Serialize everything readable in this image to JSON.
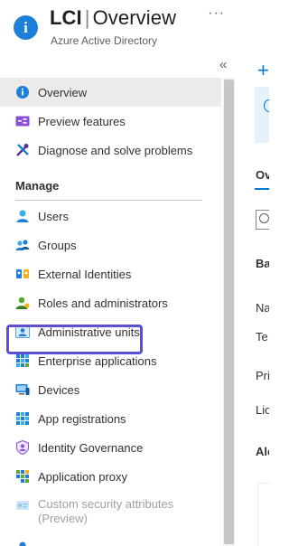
{
  "header": {
    "title_bold": "LCI",
    "title_sep": "|",
    "title_rest": "Overview",
    "subtitle": "Azure Active Directory",
    "more": "···",
    "collapse": "«"
  },
  "menu": {
    "top_items": [
      {
        "label": "Overview",
        "icon": "info-icon",
        "selected": true
      },
      {
        "label": "Preview features",
        "icon": "preview-features-icon"
      },
      {
        "label": "Diagnose and solve problems",
        "icon": "wrench-icon"
      }
    ],
    "section_manage": "Manage",
    "manage_items": [
      {
        "label": "Users",
        "icon": "user-icon"
      },
      {
        "label": "Groups",
        "icon": "groups-icon"
      },
      {
        "label": "External Identities",
        "icon": "external-identities-icon"
      },
      {
        "label": "Roles and administrators",
        "icon": "roles-icon"
      },
      {
        "label": "Administrative units",
        "icon": "administrative-units-icon"
      },
      {
        "label": "Enterprise applications",
        "icon": "enterprise-apps-icon"
      },
      {
        "label": "Devices",
        "icon": "devices-icon"
      },
      {
        "label": "App registrations",
        "icon": "app-registrations-icon"
      },
      {
        "label": "Identity Governance",
        "icon": "identity-governance-icon"
      },
      {
        "label": "Application proxy",
        "icon": "application-proxy-icon"
      }
    ],
    "custom_security": {
      "line1": "Custom security attributes",
      "line2": "(Preview)",
      "disabled": true
    }
  },
  "right_pane": {
    "add_symbol": "+",
    "tab": "Ov",
    "basic_heading": "Ba",
    "row1": "Na",
    "row2": "Te",
    "row3": "Pri",
    "row4": "Lic",
    "alerts_heading": "Ale"
  },
  "colors": {
    "accent": "#0078d4",
    "highlight_border": "#5b4fd6",
    "selected_bg": "#edebe9"
  }
}
